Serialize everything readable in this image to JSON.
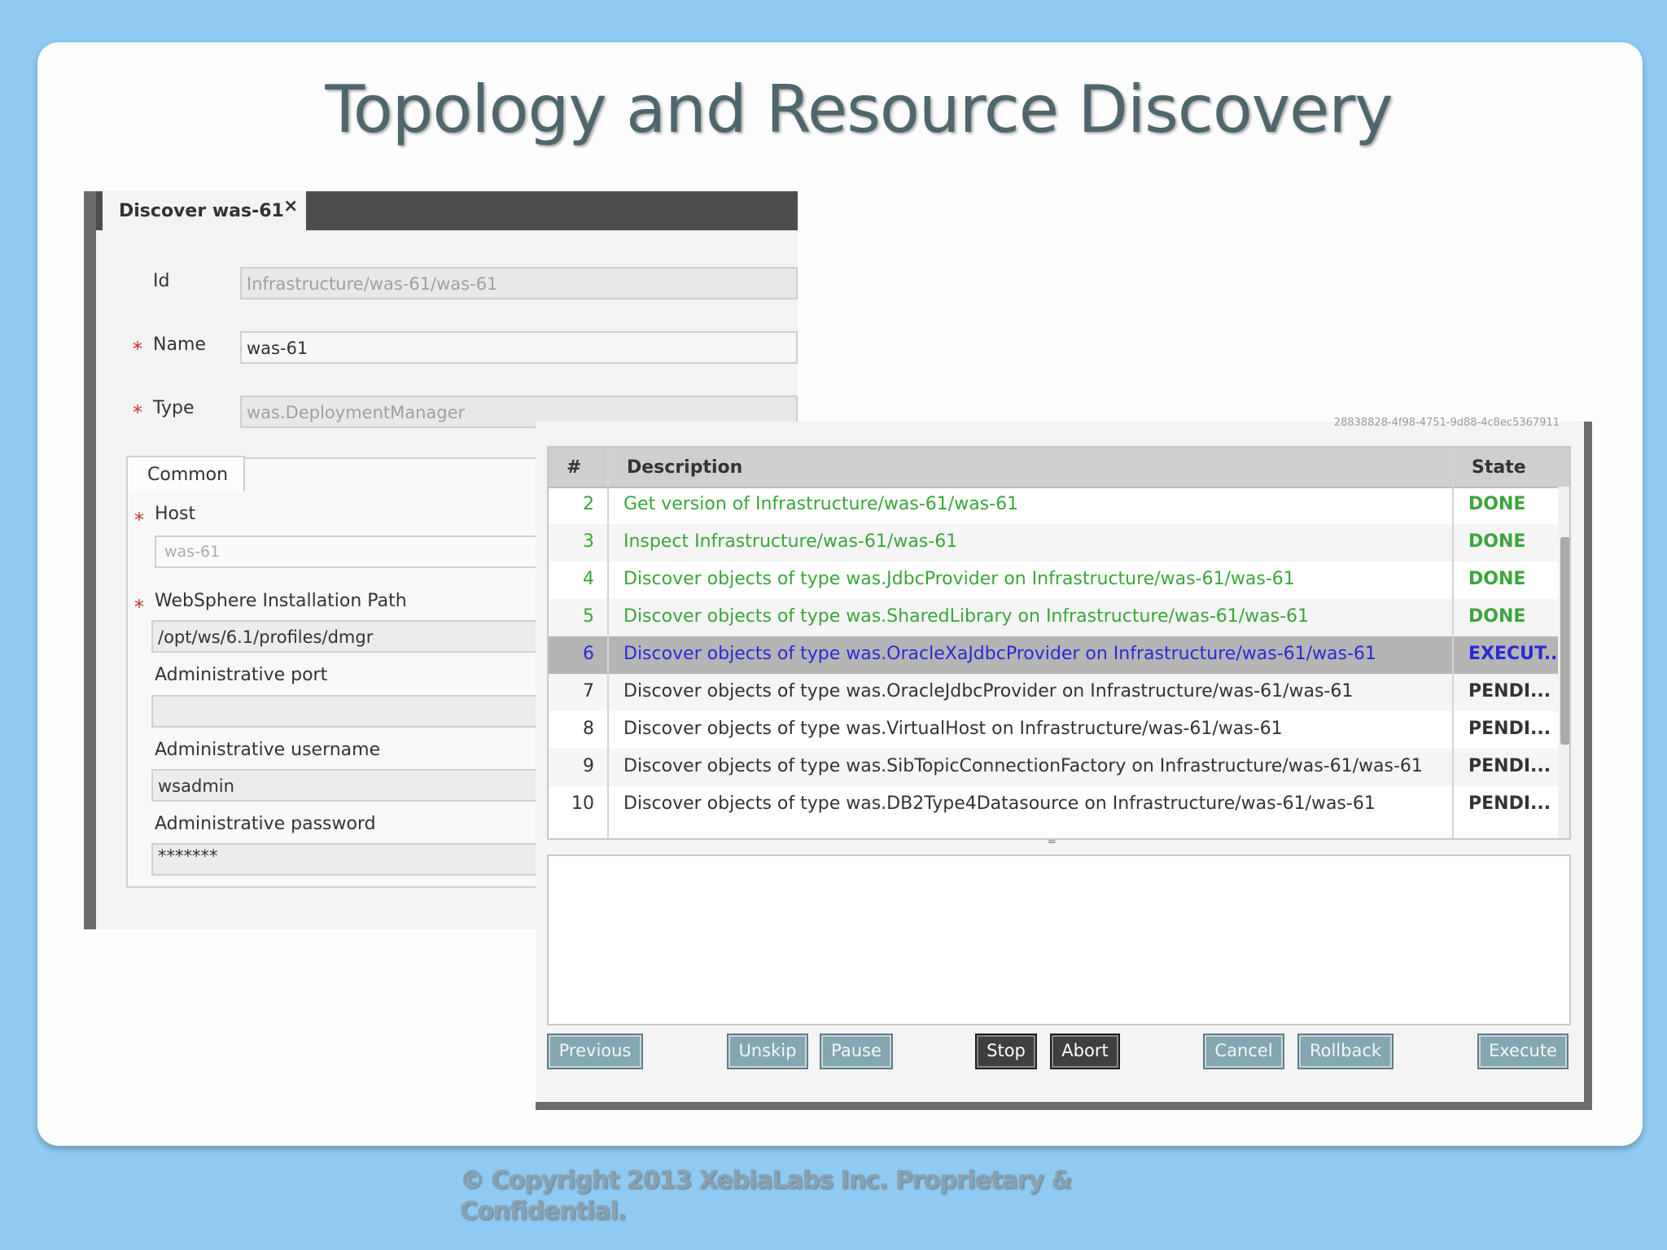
{
  "slide": {
    "title": "Topology and Resource Discovery",
    "copyright": "© Copyright 2013 XebiaLabs Inc. Proprietary & Confidential."
  },
  "discover": {
    "tab_label": "Discover was-61",
    "close_glyph": "×",
    "id_label": "Id",
    "id_value": "Infrastructure/was-61/was-61",
    "name_label": "Name",
    "name_value": "was-61",
    "type_label": "Type",
    "type_value": "was.DeploymentManager",
    "required_mark": "*",
    "common_tab": "Common",
    "host_label": "Host",
    "host_value": "was-61",
    "ws_path_label": "WebSphere Installation Path",
    "ws_path_value": "/opt/ws/6.1/profiles/dmgr",
    "admin_port_label": "Administrative port",
    "admin_port_value": "",
    "admin_user_label": "Administrative username",
    "admin_user_value": "wsadmin",
    "admin_pass_label": "Administrative password",
    "admin_pass_value": "*******"
  },
  "tasks": {
    "task_id": "28838828-4f98-4751-9d88-4c8ec5367911",
    "headers": {
      "num": "#",
      "description": "Description",
      "state": "State"
    },
    "rows": [
      {
        "num": "2",
        "description": "Get version of Infrastructure/was-61/was-61",
        "state": "DONE"
      },
      {
        "num": "3",
        "description": "Inspect Infrastructure/was-61/was-61",
        "state": "DONE"
      },
      {
        "num": "4",
        "description": "Discover objects of type was.JdbcProvider on Infrastructure/was-61/was-61",
        "state": "DONE"
      },
      {
        "num": "5",
        "description": "Discover objects of type was.SharedLibrary on Infrastructure/was-61/was-61",
        "state": "DONE"
      },
      {
        "num": "6",
        "description": "Discover objects of type was.OracleXaJdbcProvider on Infrastructure/was-61/was-61",
        "state": "EXECUT..."
      },
      {
        "num": "7",
        "description": "Discover objects of type was.OracleJdbcProvider on Infrastructure/was-61/was-61",
        "state": "PENDI..."
      },
      {
        "num": "8",
        "description": "Discover objects of type was.VirtualHost on Infrastructure/was-61/was-61",
        "state": "PENDI..."
      },
      {
        "num": "9",
        "description": "Discover objects of type was.SibTopicConnectionFactory on Infrastructure/was-61/was-61",
        "state": "PENDI..."
      },
      {
        "num": "10",
        "description": "Discover objects of type was.DB2Type4Datasource on Infrastructure/was-61/was-61",
        "state": "PENDI..."
      }
    ],
    "buttons": {
      "previous": "Previous",
      "unskip": "Unskip",
      "pause": "Pause",
      "stop": "Stop",
      "abort": "Abort",
      "cancel": "Cancel",
      "rollback": "Rollback",
      "execute": "Execute"
    }
  },
  "colors": {
    "done": "#3aa63a",
    "executing": "#2a2ad6",
    "pending": "#333333",
    "selected_row": "#b5b5b5"
  }
}
